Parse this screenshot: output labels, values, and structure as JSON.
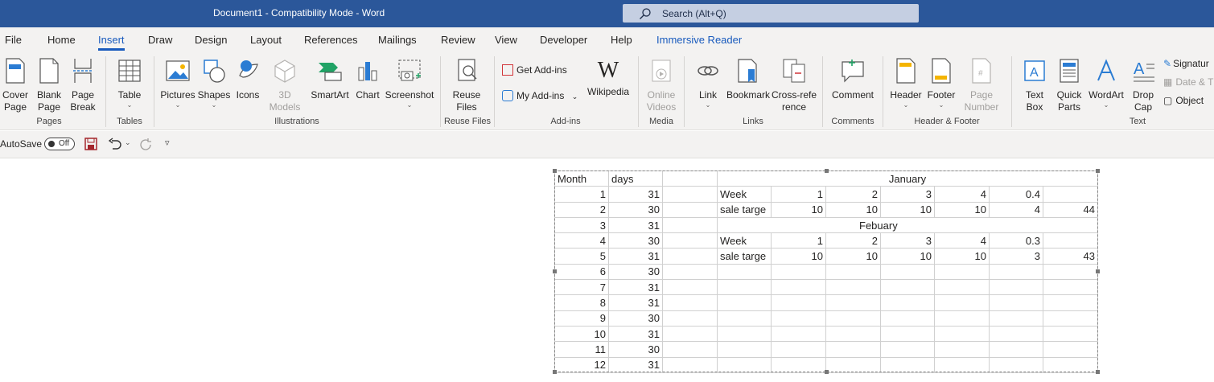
{
  "titlebar": {
    "document_title": "Document1  -  Compatibility Mode  -  Word",
    "search_placeholder": "Search (Alt+Q)"
  },
  "tabs": [
    "File",
    "Home",
    "Insert",
    "Draw",
    "Design",
    "Layout",
    "References",
    "Mailings",
    "Review",
    "View",
    "Developer",
    "Help",
    "Immersive Reader"
  ],
  "active_tab": "Insert",
  "ribbon": {
    "pages": {
      "cover_page": "Cover Page",
      "blank_page": "Blank Page",
      "page_break": "Page Break",
      "group": "Pages"
    },
    "tables": {
      "table": "Table",
      "group": "Tables"
    },
    "illustrations": {
      "pictures": "Pictures",
      "shapes": "Shapes",
      "icons": "Icons",
      "models_3d": "3D Models",
      "smartart": "SmartArt",
      "chart": "Chart",
      "screenshot": "Screenshot",
      "group": "Illustrations"
    },
    "reuse": {
      "reuse_files": "Reuse Files",
      "group": "Reuse Files"
    },
    "addins": {
      "get_addins": "Get Add-ins",
      "my_addins": "My Add-ins",
      "wikipedia": "Wikipedia",
      "group": "Add-ins"
    },
    "media": {
      "online_videos": "Online Videos",
      "group": "Media"
    },
    "links": {
      "link": "Link",
      "bookmark": "Bookmark",
      "cross_reference": "Cross-reference",
      "group": "Links"
    },
    "comments": {
      "comment": "Comment",
      "group": "Comments"
    },
    "header_footer": {
      "header": "Header",
      "footer": "Footer",
      "page_number": "Page Number",
      "group": "Header & Footer"
    },
    "text": {
      "text_box": "Text Box",
      "quick_parts": "Quick Parts",
      "wordart": "WordArt",
      "drop_cap": "Drop Cap",
      "signature": "Signatur",
      "date_time": "Date & T",
      "object": "Object",
      "group": "Text"
    }
  },
  "qat": {
    "autosave": "AutoSave",
    "toggle": "Off"
  },
  "table": {
    "header": {
      "month": "Month",
      "days": "days",
      "january": "January"
    },
    "rows": [
      {
        "month": "1",
        "days": "31"
      },
      {
        "month": "2",
        "days": "30"
      },
      {
        "month": "3",
        "days": "31"
      },
      {
        "month": "4",
        "days": "30"
      },
      {
        "month": "5",
        "days": "31"
      },
      {
        "month": "6",
        "days": "30"
      },
      {
        "month": "7",
        "days": "31"
      },
      {
        "month": "8",
        "days": "31"
      },
      {
        "month": "9",
        "days": "30"
      },
      {
        "month": "10",
        "days": "31"
      },
      {
        "month": "11",
        "days": "30"
      },
      {
        "month": "12",
        "days": "31"
      }
    ],
    "jan_week": {
      "label": "Week",
      "values": [
        "1",
        "2",
        "3",
        "4",
        "0.4",
        ""
      ]
    },
    "jan_target": {
      "label": "sale targe",
      "values": [
        "10",
        "10",
        "10",
        "10",
        "4",
        "44"
      ]
    },
    "feb_title": "Febuary",
    "feb_week": {
      "label": "Week",
      "values": [
        "1",
        "2",
        "3",
        "4",
        "0.3",
        ""
      ]
    },
    "feb_target": {
      "label": "sale targe",
      "values": [
        "10",
        "10",
        "10",
        "10",
        "3",
        "43"
      ]
    }
  },
  "colors": {
    "titlebar": "#2b579a",
    "accent": "#185abd",
    "ribbon_bg": "#f3f2f1"
  }
}
